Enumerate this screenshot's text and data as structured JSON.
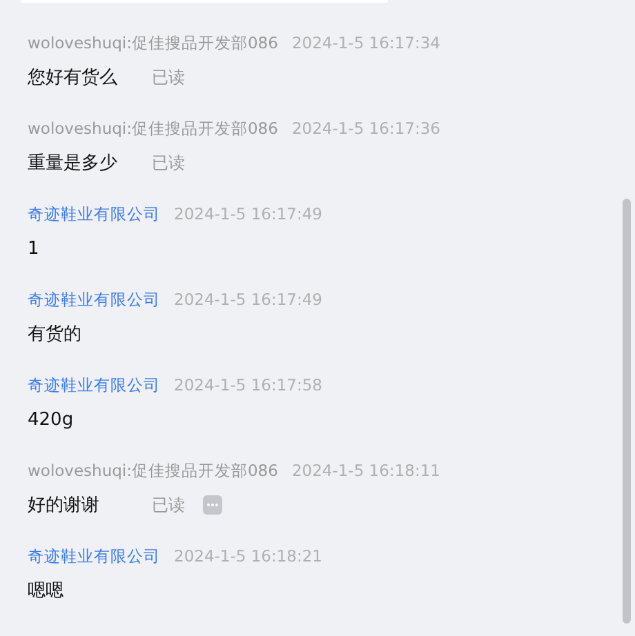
{
  "messages": [
    {
      "kind": "mine",
      "sender": "woloveshuqi:促佳搜品开发部086",
      "time": "2024-1-5 16:17:34",
      "text": "您好有货么",
      "status": "已读",
      "more": false
    },
    {
      "kind": "mine",
      "sender": "woloveshuqi:促佳搜品开发部086",
      "time": "2024-1-5 16:17:36",
      "text": "重量是多少",
      "status": "已读",
      "more": false
    },
    {
      "kind": "other",
      "sender": "奇迹鞋业有限公司",
      "time": "2024-1-5 16:17:49",
      "text": "1"
    },
    {
      "kind": "other",
      "sender": "奇迹鞋业有限公司",
      "time": "2024-1-5 16:17:49",
      "text": "有货的"
    },
    {
      "kind": "other",
      "sender": "奇迹鞋业有限公司",
      "time": "2024-1-5 16:17:58",
      "text": "420g"
    },
    {
      "kind": "mine",
      "sender": "woloveshuqi:促佳搜品开发部086",
      "time": "2024-1-5 16:18:11",
      "text": "好的谢谢",
      "status": "已读",
      "more": true
    },
    {
      "kind": "other",
      "sender": "奇迹鞋业有限公司",
      "time": "2024-1-5 16:18:21",
      "text": "嗯嗯"
    }
  ]
}
